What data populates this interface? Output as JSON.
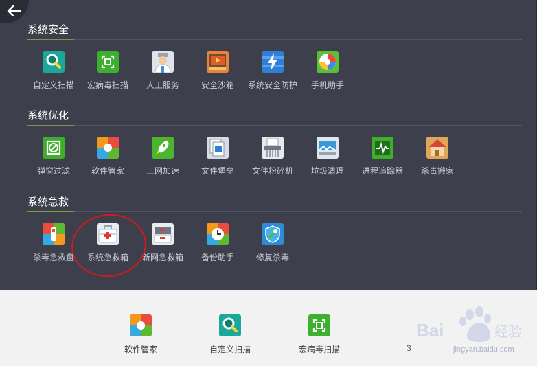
{
  "sections": [
    {
      "title": "系统安全",
      "tools": [
        {
          "label": "自定义扫描",
          "icon": "magnifier-icon"
        },
        {
          "label": "宏病毒扫描",
          "icon": "macro-scan-icon"
        },
        {
          "label": "人工服务",
          "icon": "doctor-icon"
        },
        {
          "label": "安全沙箱",
          "icon": "sandbox-icon"
        },
        {
          "label": "系统安全防护",
          "icon": "lightning-shield-icon"
        },
        {
          "label": "手机助手",
          "icon": "phone-ball-icon"
        }
      ]
    },
    {
      "title": "系统优化",
      "tools": [
        {
          "label": "弹窗过滤",
          "icon": "popup-block-icon"
        },
        {
          "label": "软件管家",
          "icon": "pinwheel-icon"
        },
        {
          "label": "上网加速",
          "icon": "rocket-icon"
        },
        {
          "label": "文件堡垒",
          "icon": "file-vault-icon"
        },
        {
          "label": "文件粉碎机",
          "icon": "shredder-icon"
        },
        {
          "label": "垃圾清理",
          "icon": "broom-icon"
        },
        {
          "label": "进程追踪器",
          "icon": "pulse-icon"
        },
        {
          "label": "杀毒搬家",
          "icon": "house-icon"
        }
      ]
    },
    {
      "title": "系统急救",
      "tools": [
        {
          "label": "杀毒急救盘",
          "icon": "usb-rescue-icon"
        },
        {
          "label": "系统急救箱",
          "icon": "first-aid-kit-icon"
        },
        {
          "label": "新网急救箱",
          "icon": "tray-icon"
        },
        {
          "label": "备份助手",
          "icon": "backup-clock-icon"
        },
        {
          "label": "修复杀毒",
          "icon": "repair-shield-icon"
        }
      ]
    }
  ],
  "bottom": {
    "tools": [
      {
        "label": "软件管家",
        "icon": "pinwheel-icon"
      },
      {
        "label": "自定义扫描",
        "icon": "magnifier-icon"
      },
      {
        "label": "宏病毒扫描",
        "icon": "macro-scan-icon"
      }
    ],
    "number": "3"
  },
  "watermark": {
    "logo": "Bai du 经验",
    "url": "jingyan.baidu.com"
  },
  "colors": {
    "panel": "#3d3f4c",
    "accent_line": "#7a9a3d",
    "highlight_circle": "#d11b1b"
  }
}
